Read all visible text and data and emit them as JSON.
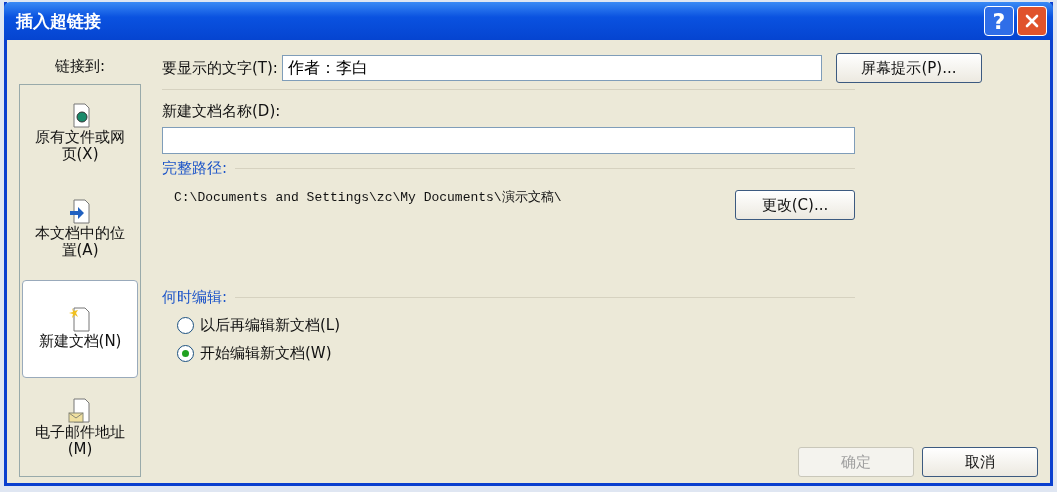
{
  "window": {
    "title": "插入超链接",
    "help_button": "?"
  },
  "link_to": {
    "label": "链接到:",
    "items": [
      {
        "kind": "existing",
        "label": "原有文件或网页(X)",
        "selected": false
      },
      {
        "kind": "place",
        "label": "本文档中的位置(A)",
        "selected": false
      },
      {
        "kind": "new",
        "label": "新建文档(N)",
        "selected": true
      },
      {
        "kind": "email",
        "label": "电子邮件地址(M)",
        "selected": false
      }
    ]
  },
  "display_text": {
    "label": "要显示的文字(T):",
    "value": "作者：李白"
  },
  "screentip_button": "屏幕提示(P)...",
  "new_document_name": {
    "label": "新建文档名称(D):"
  },
  "full_path": {
    "label": "完整路径:",
    "path": "C:\\Documents and Settings\\zc\\My Documents\\演示文稿\\"
  },
  "change_button": "更改(C)...",
  "when_to_edit": {
    "label": "何时编辑:",
    "options": [
      {
        "label": "以后再编辑新文档(L)",
        "selected": false
      },
      {
        "label": "开始编辑新文档(W)",
        "selected": true
      }
    ]
  },
  "buttons": [
    {
      "label": "确定",
      "disabled": true
    },
    {
      "label": "取消",
      "disabled": false
    }
  ]
}
